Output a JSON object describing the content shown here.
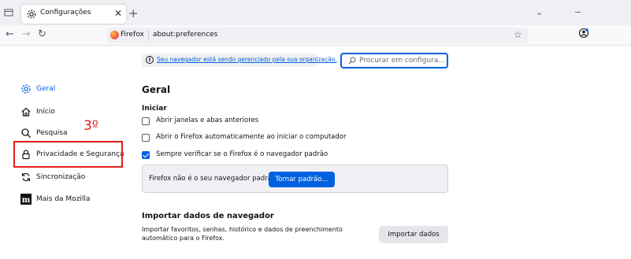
{
  "browser": {
    "tab": {
      "title": "Configurações",
      "icon": "gear-icon"
    },
    "new_tab_label": "+",
    "url_identity": "Firefox",
    "url": "about:preferences",
    "controls": {
      "minimize": "−",
      "list": "⌄"
    }
  },
  "banner": {
    "text": "Seu navegador está sendo gerenciado pela sua organização."
  },
  "search": {
    "placeholder": "Procurar em configura..."
  },
  "sidebar": {
    "items": [
      {
        "label": "Geral",
        "icon": "gear-icon",
        "active": true
      },
      {
        "label": "Início",
        "icon": "home-icon"
      },
      {
        "label": "Pesquisa",
        "icon": "search-icon"
      },
      {
        "label": "Privacidade e Segurança",
        "icon": "lock-icon"
      },
      {
        "label": "Sincronização",
        "icon": "sync-icon"
      },
      {
        "label": "Mais da Mozilla",
        "icon": "mozilla-icon"
      }
    ]
  },
  "annotation": {
    "text": "3º",
    "color": "#e11d1d"
  },
  "main": {
    "title": "Geral",
    "startup": {
      "heading": "Iniciar",
      "options": [
        {
          "label": "Abrir janelas e abas anteriores",
          "checked": false
        },
        {
          "label": "Abrir o Firefox automaticamente ao iniciar o computador",
          "checked": false
        },
        {
          "label": "Sempre verificar se o Firefox é o navegador padrão",
          "checked": true
        }
      ]
    },
    "default_browser": {
      "text": "Firefox não é o seu navegador padrão",
      "button": "Tornar padrão..."
    },
    "import": {
      "title": "Importar dados de navegador",
      "description": "Importar favoritos, senhas, histórico e dados de preenchimento automático para o Firefox.",
      "button": "Importar dados"
    }
  },
  "colors": {
    "accent": "#0061e0",
    "highlight": "#e11d1d"
  }
}
